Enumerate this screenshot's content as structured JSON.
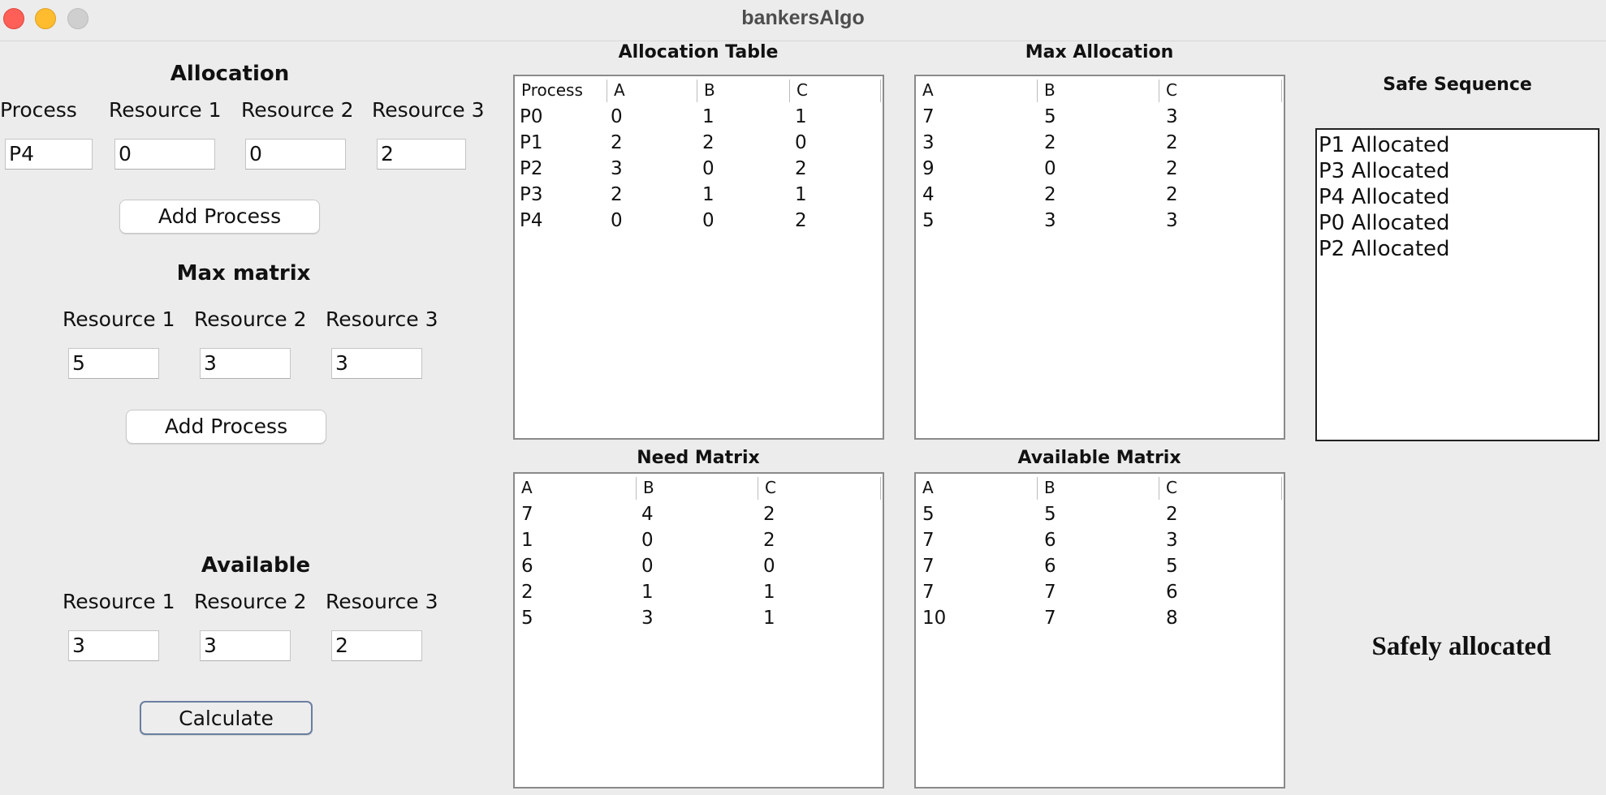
{
  "window": {
    "title": "bankersAlgo"
  },
  "allocation": {
    "heading": "Allocation",
    "process_label": "Process",
    "resource_labels": [
      "Resource 1",
      "Resource 2",
      "Resource 3"
    ],
    "process_value": "P4",
    "values": [
      "0",
      "0",
      "2"
    ],
    "add_button": "Add Process"
  },
  "max_matrix": {
    "heading": "Max matrix",
    "resource_labels": [
      "Resource 1",
      "Resource 2",
      "Resource 3"
    ],
    "values": [
      "5",
      "3",
      "3"
    ],
    "add_button": "Add Process"
  },
  "available": {
    "heading": "Available",
    "resource_labels": [
      "Resource 1",
      "Resource 2",
      "Resource 3"
    ],
    "values": [
      "3",
      "3",
      "2"
    ],
    "calculate_button": "Calculate"
  },
  "allocation_table": {
    "title": "Allocation Table",
    "columns": [
      "Process",
      "A",
      "B",
      "C"
    ],
    "rows": [
      [
        "P0",
        "0",
        "1",
        "1"
      ],
      [
        "P1",
        "2",
        "2",
        "0"
      ],
      [
        "P2",
        "3",
        "0",
        "2"
      ],
      [
        "P3",
        "2",
        "1",
        "1"
      ],
      [
        "P4",
        "0",
        "0",
        "2"
      ]
    ]
  },
  "max_allocation_table": {
    "title": "Max Allocation",
    "columns": [
      "A",
      "B",
      "C"
    ],
    "rows": [
      [
        "7",
        "5",
        "3"
      ],
      [
        "3",
        "2",
        "2"
      ],
      [
        "9",
        "0",
        "2"
      ],
      [
        "4",
        "2",
        "2"
      ],
      [
        "5",
        "3",
        "3"
      ]
    ]
  },
  "need_matrix_table": {
    "title": "Need Matrix",
    "columns": [
      "A",
      "B",
      "C"
    ],
    "rows": [
      [
        "7",
        "4",
        "2"
      ],
      [
        "1",
        "0",
        "2"
      ],
      [
        "6",
        "0",
        "0"
      ],
      [
        "2",
        "1",
        "1"
      ],
      [
        "5",
        "3",
        "1"
      ]
    ]
  },
  "available_matrix_table": {
    "title": "Available Matrix",
    "columns": [
      "A",
      "B",
      "C"
    ],
    "rows": [
      [
        "5",
        "5",
        "2"
      ],
      [
        "7",
        "6",
        "3"
      ],
      [
        "7",
        "6",
        "5"
      ],
      [
        "7",
        "7",
        "6"
      ],
      [
        "10",
        "7",
        "8"
      ]
    ]
  },
  "safe_sequence": {
    "title": "Safe Sequence",
    "lines": [
      "P1 Allocated",
      "P3 Allocated",
      "P4 Allocated",
      "P0 Allocated",
      "P2 Allocated"
    ],
    "status": "Safely allocated"
  }
}
